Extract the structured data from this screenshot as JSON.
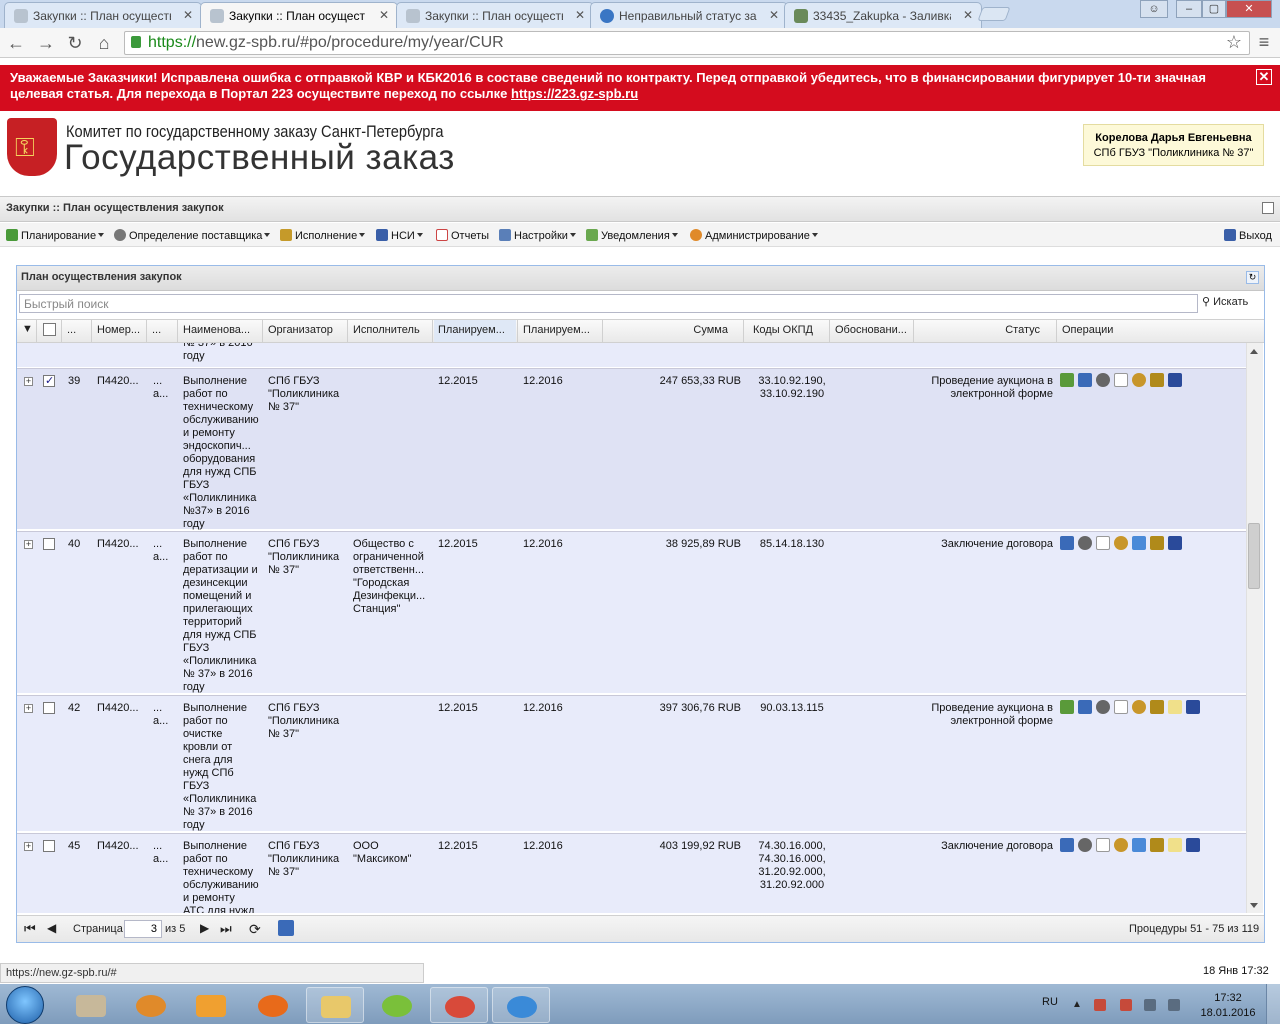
{
  "browser": {
    "tabs": [
      {
        "label": "Закупки :: План осуществ",
        "active": false
      },
      {
        "label": "Закупки :: План осущест",
        "active": true
      },
      {
        "label": "Закупки :: План осуществ",
        "active": false
      },
      {
        "label": "Неправильный статус зак",
        "active": false
      },
      {
        "label": "33435_Zakupka - Заливка",
        "active": false
      }
    ],
    "url_scheme": "https://",
    "url_rest": "new.gz-spb.ru/#po/procedure/my/year/CUR",
    "status_url": "https://new.gz-spb.ru/#"
  },
  "banner": {
    "text": "Уважаемые Заказчики! Исправлена ошибка с отправкой КВР и КБК2016 в составе сведений по контракту. Перед отправкой убедитесь, что в финансировании фигурирует 10-ти значная целевая статья. Для перехода в Портал 223 осуществите переход по ссылке ",
    "link": "https://223.gz-spb.ru",
    "close": "✕"
  },
  "header": {
    "committee": "Комитет по государственному заказу Санкт-Петербурга",
    "site_name": "Государственный заказ",
    "user_name": "Корелова Дарья Евгеньевна",
    "user_org": "СПб ГБУЗ \"Поликлиника № 37\""
  },
  "section": {
    "title": "Закупки :: План осуществления закупок"
  },
  "menu": {
    "items": [
      "Планирование",
      "Определение поставщика",
      "Исполнение",
      "НСИ",
      "Отчеты",
      "Настройки",
      "Уведомления",
      "Администрирование"
    ],
    "exit": "Выход"
  },
  "panel": {
    "title": "План осуществления закупок",
    "search_placeholder": "Быстрый поиск",
    "search_button": "Искать"
  },
  "grid": {
    "columns": [
      "...",
      "Номер...",
      "...",
      "Наименова...",
      "Организатор",
      "Исполнитель",
      "Планируем...",
      "Планируем...",
      "Сумма",
      "Коды ОКПД",
      "Обосновани...",
      "Статус",
      "Операции"
    ],
    "partial_top": "№ 37» в 2016\nгоду",
    "rows": [
      {
        "num": "39",
        "number": "П4420...",
        "dots": "...\nа...",
        "name": "Выполнение\nработ по\nтехническому\nобслуживанию\nи ремонту\nэндоскопич...\nоборудования\nдля нужд СПБ\nГБУЗ\n«Поликлиника\n№37» в 2016\nгоду",
        "organizer": "СПб ГБУЗ\n\"Поликлиника\n№ 37\"",
        "executor": "",
        "plan1": "12.2015",
        "plan2": "12.2016",
        "sum": "247 653,33 RUB",
        "okpd": "33.10.92.190,\n33.10.92.190",
        "status": "Проведение аукциона в\nэлектронной форме",
        "checked": true
      },
      {
        "num": "40",
        "number": "П4420...",
        "dots": "...\nа...",
        "name": "Выполнение\nработ по\nдератизации и\nдезинсекции\nпомещений и\nприлегающих\nтерриторий\nдля нужд СПБ\nГБУЗ\n«Поликлиника\n№ 37» в 2016\nгоду",
        "organizer": "СПб ГБУЗ\n\"Поликлиника\n№ 37\"",
        "executor": "Общество с\nограниченной\nответственн...\n\"Городская\nДезинфекци...\nСтанция\"",
        "plan1": "12.2015",
        "plan2": "12.2016",
        "sum": "38 925,89 RUB",
        "okpd": "85.14.18.130",
        "status": "Заключение договора",
        "checked": false
      },
      {
        "num": "42",
        "number": "П4420...",
        "dots": "...\nа...",
        "name": "Выполнение\nработ по\nочистке\nкровли от\nснега для\nнужд СПб\nГБУЗ\n«Поликлиника\n№ 37» в 2016\nгоду",
        "organizer": "СПб ГБУЗ\n\"Поликлиника\n№ 37\"",
        "executor": "",
        "plan1": "12.2015",
        "plan2": "12.2016",
        "sum": "397 306,76 RUB",
        "okpd": "90.03.13.115",
        "status": "Проведение аукциона в\nэлектронной форме",
        "checked": false
      },
      {
        "num": "45",
        "number": "П4420...",
        "dots": "...\nа...",
        "name": "Выполнение\nработ по\nтехническому\nобслуживанию\nи ремонту\nАТС для нужд",
        "organizer": "СПб ГБУЗ\n\"Поликлиника\n№ 37\"",
        "executor": "ООО\n\"Максиком\"",
        "plan1": "12.2015",
        "plan2": "12.2016",
        "sum": "403 199,92 RUB",
        "okpd": "74.30.16.000,\n74.30.16.000,\n31.20.92.000,\n31.20.92.000",
        "status": "Заключение договора",
        "checked": false
      }
    ]
  },
  "pager": {
    "page_label": "Страница",
    "page": "3",
    "of": "из 5",
    "summary": "Процедуры 51 - 75 из 119"
  },
  "system": {
    "status_datetime": "18 Янв 17:32",
    "lang": "RU",
    "time": "17:32",
    "date": "18.01.2016"
  },
  "colors": {
    "banner": "#d40c1e",
    "row_bg": "#e8ebfa",
    "panel_border": "#99bbe8"
  }
}
